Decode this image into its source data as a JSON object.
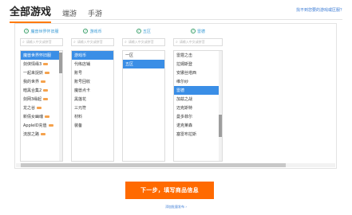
{
  "header": {
    "title": "全部游戏",
    "tabs": [
      "端游",
      "手游"
    ],
    "help_link": "找不到您要的游戏或区服？"
  },
  "columns": [
    {
      "header": "魔兽世界怀旧服",
      "search_placeholder": "请输入中文或拼音",
      "items": [
        {
          "label": "魔兽世界怀旧服",
          "selected": true,
          "badge": false
        },
        {
          "label": "剑侠情缘3",
          "selected": false,
          "badge": true
        },
        {
          "label": "一起来捉妖",
          "selected": false,
          "badge": true
        },
        {
          "label": "我的世界",
          "selected": false,
          "badge": true
        },
        {
          "label": "暗黑合集2",
          "selected": false,
          "badge": true
        },
        {
          "label": "剑网3缘起",
          "selected": false,
          "badge": true
        },
        {
          "label": "龙之谷",
          "selected": false,
          "badge": true
        },
        {
          "label": "新倩女幽魂",
          "selected": false,
          "badge": true
        },
        {
          "label": "AppleID充值",
          "selected": false,
          "badge": true
        },
        {
          "label": "流放之路",
          "selected": false,
          "badge": true
        }
      ]
    },
    {
      "header": "游戏币",
      "search_placeholder": "请输入中文或拼音",
      "items": [
        {
          "label": "游戏币",
          "selected": true
        },
        {
          "label": "代练店铺",
          "selected": false
        },
        {
          "label": "账号",
          "selected": false
        },
        {
          "label": "账号回收",
          "selected": false
        },
        {
          "label": "魔兽点卡",
          "selected": false
        },
        {
          "label": "黑莲花",
          "selected": false
        },
        {
          "label": "三元符",
          "selected": false
        },
        {
          "label": "材料",
          "selected": false
        },
        {
          "label": "装备",
          "selected": false
        }
      ]
    },
    {
      "header": "五区",
      "search_placeholder": "请输入中文或拼音",
      "items": [
        {
          "label": "一区",
          "selected": false
        },
        {
          "label": "五区",
          "selected": true
        }
      ]
    },
    {
      "header": "雷德",
      "search_placeholder": "请输入中文或拼音",
      "items": [
        {
          "label": "雷霆之击",
          "selected": false
        },
        {
          "label": "拉姆斯登",
          "selected": false
        },
        {
          "label": "安娜丝塔西",
          "selected": false
        },
        {
          "label": "维尔纱",
          "selected": false
        },
        {
          "label": "雷德",
          "selected": true
        },
        {
          "label": "加兹之战",
          "selected": false
        },
        {
          "label": "迈克斯特",
          "selected": false
        },
        {
          "label": "曼多菲尔",
          "selected": false
        },
        {
          "label": "诺克莱森",
          "selected": false
        },
        {
          "label": "塞雷布拉斯",
          "selected": false
        }
      ]
    }
  ],
  "actions": {
    "next_button": "下一步，填写商品信息",
    "bottom_link": "添加批量发布 ›"
  },
  "colors": {
    "accent": "#ff6a00",
    "selected": "#3a8ee6",
    "link": "#3a7bd5"
  }
}
